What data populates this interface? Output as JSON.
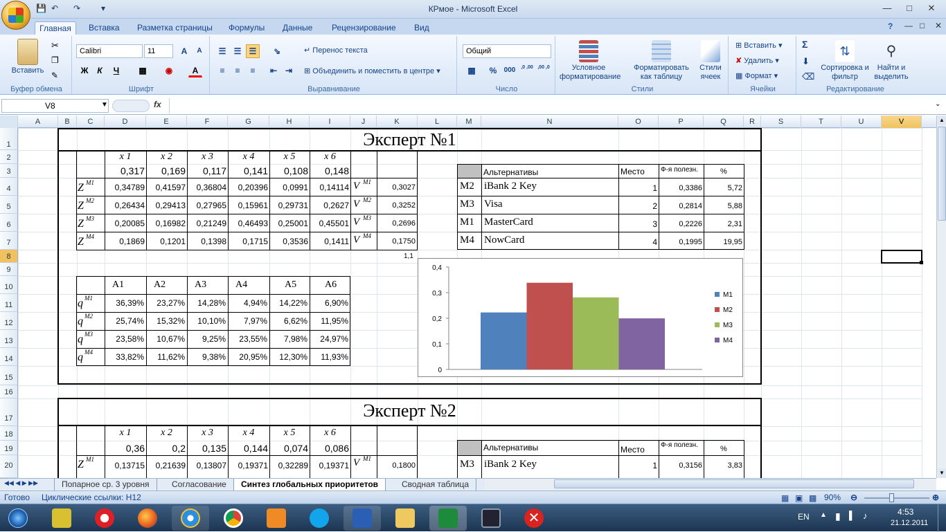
{
  "window": {
    "title": "КРмое - Microsoft Excel"
  },
  "ribbon_tabs": [
    "Главная",
    "Вставка",
    "Разметка страницы",
    "Формулы",
    "Данные",
    "Рецензирование",
    "Вид"
  ],
  "ribbon": {
    "clipboard": {
      "paste": "Вставить",
      "label": "Буфер обмена"
    },
    "font": {
      "name": "Calibri",
      "size": "11",
      "label": "Шрифт",
      "bold": "Ж",
      "italic": "К",
      "underline": "Ч"
    },
    "alignment": {
      "wrap": "Перенос текста",
      "merge": "Объединить и поместить в центре",
      "label": "Выравнивание"
    },
    "number": {
      "format": "Общий",
      "label": "Число",
      "percent": "%",
      "thousands": "000",
      "inc_dec": ",0 ,00",
      "dec_dec": ",00 ,0"
    },
    "styles": {
      "conditional": "Условное форматирование",
      "as_table": "Форматировать как таблицу",
      "cell_styles": "Стили ячеек",
      "label": "Стили"
    },
    "cells": {
      "insert": "Вставить",
      "delete": "Удалить",
      "format": "Формат",
      "label": "Ячейки"
    },
    "editing": {
      "sum": "Σ",
      "sort": "Сортировка и фильтр",
      "find": "Найти и выделить",
      "label": "Редактирование"
    }
  },
  "formula_bar": {
    "name_box": "V8",
    "fx": "fx",
    "value": ""
  },
  "columns": [
    "A",
    "B",
    "C",
    "D",
    "E",
    "F",
    "G",
    "H",
    "I",
    "J",
    "K",
    "L",
    "M",
    "N",
    "O",
    "P",
    "Q",
    "R",
    "S",
    "T",
    "U",
    "V"
  ],
  "rows": [
    "1",
    "2",
    "3",
    "4",
    "5",
    "6",
    "7",
    "8",
    "9",
    "10",
    "11",
    "12",
    "13",
    "14",
    "15",
    "16",
    "17",
    "18",
    "19",
    "20"
  ],
  "expert1": {
    "title": "Эксперт №1",
    "x_headers": [
      "x 1",
      "x 2",
      "x 3",
      "x 4",
      "x 5",
      "x 6"
    ],
    "weights": [
      "0,317",
      "0,169",
      "0,117",
      "0,141",
      "0,108",
      "0,148"
    ],
    "z_labels": [
      "Z",
      "Z",
      "Z",
      "Z"
    ],
    "z_sup": [
      "M1",
      "M2",
      "M3",
      "M4"
    ],
    "z_rows": [
      [
        "0,34789",
        "0,41597",
        "0,36804",
        "0,20396",
        "0,0991",
        "0,14114"
      ],
      [
        "0,26434",
        "0,29413",
        "0,27965",
        "0,15961",
        "0,29731",
        "0,2627"
      ],
      [
        "0,20085",
        "0,16982",
        "0,21249",
        "0,46493",
        "0,25001",
        "0,45501"
      ],
      [
        "0,1869",
        "0,1201",
        "0,1398",
        "0,1715",
        "0,3536",
        "0,1411"
      ]
    ],
    "v_label": "V",
    "v_values": [
      "0,3027",
      "0,3252",
      "0,2696",
      "0,1750"
    ],
    "small_note": "1,1",
    "rank_table": {
      "headers": [
        "Альтернативы",
        "Место",
        "Ф-я полезн.",
        "%"
      ],
      "rows": [
        {
          "m": "M2",
          "name": "iBank 2 Key",
          "place": "1",
          "util": "0,3386",
          "pct": "5,72"
        },
        {
          "m": "M3",
          "name": "Visa",
          "place": "2",
          "util": "0,2814",
          "pct": "5,88"
        },
        {
          "m": "M1",
          "name": "MasterCard",
          "place": "3",
          "util": "0,2226",
          "pct": "2,31"
        },
        {
          "m": "M4",
          "name": "NowCard",
          "place": "4",
          "util": "0,1995",
          "pct": "19,95"
        }
      ]
    },
    "a_headers": [
      "A1",
      "A2",
      "A3",
      "A4",
      "A5",
      "A6"
    ],
    "q_label": "q",
    "q_rows": [
      [
        "36,39%",
        "23,27%",
        "14,28%",
        "4,94%",
        "14,22%",
        "6,90%"
      ],
      [
        "25,74%",
        "15,32%",
        "10,10%",
        "7,97%",
        "6,62%",
        "11,95%"
      ],
      [
        "23,58%",
        "10,67%",
        "9,25%",
        "23,55%",
        "7,98%",
        "24,97%"
      ],
      [
        "33,82%",
        "11,62%",
        "9,38%",
        "20,95%",
        "12,30%",
        "11,93%"
      ]
    ]
  },
  "chart_data": {
    "type": "bar",
    "title": "",
    "categories": [
      ""
    ],
    "series": [
      {
        "name": "M1",
        "values": [
          0.2226
        ],
        "color": "#4f81bd"
      },
      {
        "name": "M2",
        "values": [
          0.3386
        ],
        "color": "#c0504d"
      },
      {
        "name": "M3",
        "values": [
          0.2814
        ],
        "color": "#9bbb59"
      },
      {
        "name": "M4",
        "values": [
          0.1995
        ],
        "color": "#8064a2"
      }
    ],
    "ylim": [
      0,
      0.4
    ],
    "yticks": [
      "0",
      "0,1",
      "0,2",
      "0,3",
      "0,4"
    ],
    "legend": "right",
    "grid": false
  },
  "expert2": {
    "title": "Эксперт №2",
    "x_headers": [
      "x 1",
      "x 2",
      "x 3",
      "x 4",
      "x 5",
      "x 6"
    ],
    "weights": [
      "0,36",
      "0,2",
      "0,135",
      "0,144",
      "0,074",
      "0,086"
    ],
    "z_row1": [
      "0,13715",
      "0,21639",
      "0,13807",
      "0,19371",
      "0,32289",
      "0,19371"
    ],
    "v1": "0,1800",
    "rank_table": {
      "headers": [
        "Альтернативы",
        "Место",
        "Ф-я полезн.",
        "%"
      ],
      "row1": {
        "m": "M3",
        "name": "iBank 2 Key",
        "place": "1",
        "util": "0,3156",
        "pct": "3,83"
      }
    }
  },
  "sheet_tabs": [
    "Попарное ср. 3 уровня",
    "Согласование",
    "Синтез глобальных приоритетов",
    "Сводная таблица"
  ],
  "status": {
    "ready": "Готово",
    "circular": "Циклические ссылки: H12",
    "zoom": "90%"
  },
  "taskbar": {
    "lang": "EN",
    "time": "4:53",
    "date": "21.12.2011"
  }
}
